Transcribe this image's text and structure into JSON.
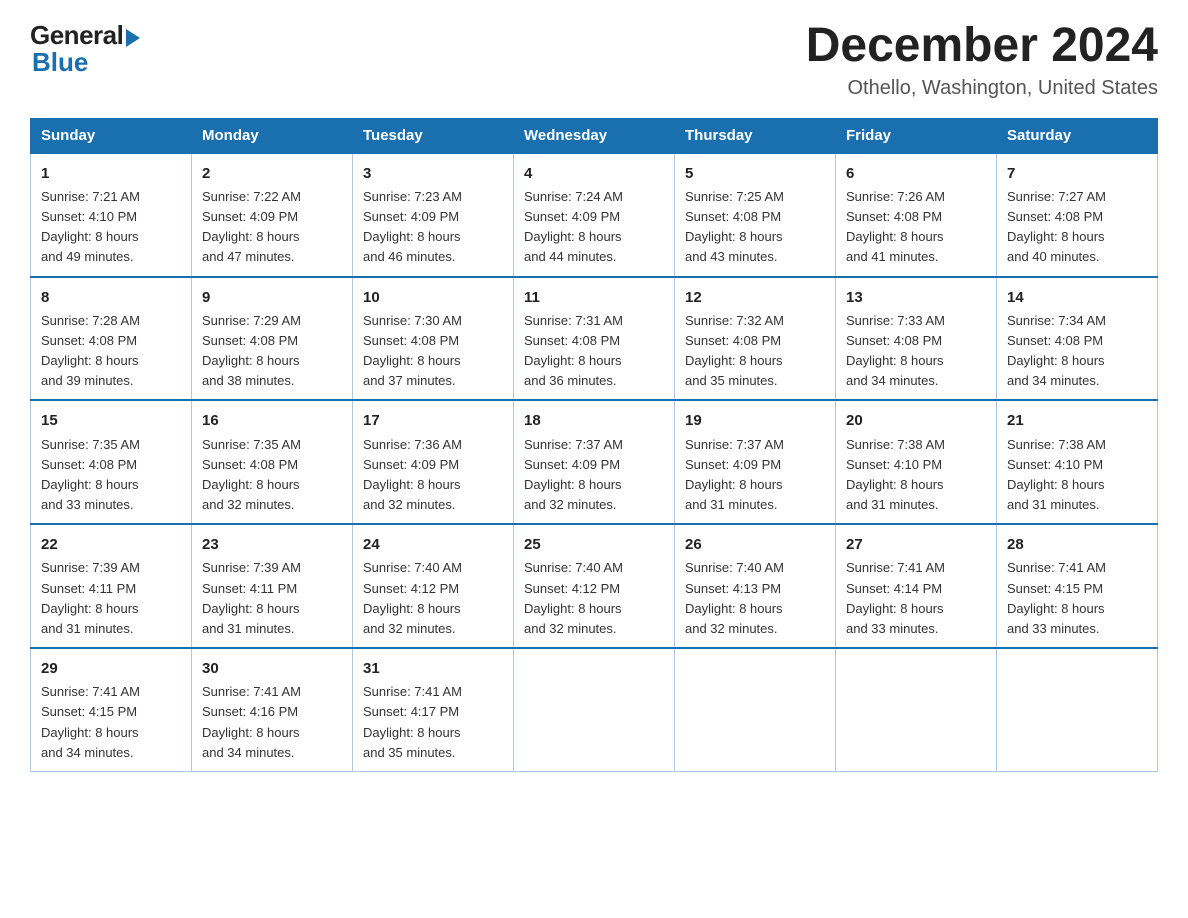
{
  "header": {
    "logo_general": "General",
    "logo_blue": "Blue",
    "month_title": "December 2024",
    "location": "Othello, Washington, United States"
  },
  "days_of_week": [
    "Sunday",
    "Monday",
    "Tuesday",
    "Wednesday",
    "Thursday",
    "Friday",
    "Saturday"
  ],
  "weeks": [
    [
      {
        "day": "1",
        "sunrise": "7:21 AM",
        "sunset": "4:10 PM",
        "daylight": "8 hours and 49 minutes."
      },
      {
        "day": "2",
        "sunrise": "7:22 AM",
        "sunset": "4:09 PM",
        "daylight": "8 hours and 47 minutes."
      },
      {
        "day": "3",
        "sunrise": "7:23 AM",
        "sunset": "4:09 PM",
        "daylight": "8 hours and 46 minutes."
      },
      {
        "day": "4",
        "sunrise": "7:24 AM",
        "sunset": "4:09 PM",
        "daylight": "8 hours and 44 minutes."
      },
      {
        "day": "5",
        "sunrise": "7:25 AM",
        "sunset": "4:08 PM",
        "daylight": "8 hours and 43 minutes."
      },
      {
        "day": "6",
        "sunrise": "7:26 AM",
        "sunset": "4:08 PM",
        "daylight": "8 hours and 41 minutes."
      },
      {
        "day": "7",
        "sunrise": "7:27 AM",
        "sunset": "4:08 PM",
        "daylight": "8 hours and 40 minutes."
      }
    ],
    [
      {
        "day": "8",
        "sunrise": "7:28 AM",
        "sunset": "4:08 PM",
        "daylight": "8 hours and 39 minutes."
      },
      {
        "day": "9",
        "sunrise": "7:29 AM",
        "sunset": "4:08 PM",
        "daylight": "8 hours and 38 minutes."
      },
      {
        "day": "10",
        "sunrise": "7:30 AM",
        "sunset": "4:08 PM",
        "daylight": "8 hours and 37 minutes."
      },
      {
        "day": "11",
        "sunrise": "7:31 AM",
        "sunset": "4:08 PM",
        "daylight": "8 hours and 36 minutes."
      },
      {
        "day": "12",
        "sunrise": "7:32 AM",
        "sunset": "4:08 PM",
        "daylight": "8 hours and 35 minutes."
      },
      {
        "day": "13",
        "sunrise": "7:33 AM",
        "sunset": "4:08 PM",
        "daylight": "8 hours and 34 minutes."
      },
      {
        "day": "14",
        "sunrise": "7:34 AM",
        "sunset": "4:08 PM",
        "daylight": "8 hours and 34 minutes."
      }
    ],
    [
      {
        "day": "15",
        "sunrise": "7:35 AM",
        "sunset": "4:08 PM",
        "daylight": "8 hours and 33 minutes."
      },
      {
        "day": "16",
        "sunrise": "7:35 AM",
        "sunset": "4:08 PM",
        "daylight": "8 hours and 32 minutes."
      },
      {
        "day": "17",
        "sunrise": "7:36 AM",
        "sunset": "4:09 PM",
        "daylight": "8 hours and 32 minutes."
      },
      {
        "day": "18",
        "sunrise": "7:37 AM",
        "sunset": "4:09 PM",
        "daylight": "8 hours and 32 minutes."
      },
      {
        "day": "19",
        "sunrise": "7:37 AM",
        "sunset": "4:09 PM",
        "daylight": "8 hours and 31 minutes."
      },
      {
        "day": "20",
        "sunrise": "7:38 AM",
        "sunset": "4:10 PM",
        "daylight": "8 hours and 31 minutes."
      },
      {
        "day": "21",
        "sunrise": "7:38 AM",
        "sunset": "4:10 PM",
        "daylight": "8 hours and 31 minutes."
      }
    ],
    [
      {
        "day": "22",
        "sunrise": "7:39 AM",
        "sunset": "4:11 PM",
        "daylight": "8 hours and 31 minutes."
      },
      {
        "day": "23",
        "sunrise": "7:39 AM",
        "sunset": "4:11 PM",
        "daylight": "8 hours and 31 minutes."
      },
      {
        "day": "24",
        "sunrise": "7:40 AM",
        "sunset": "4:12 PM",
        "daylight": "8 hours and 32 minutes."
      },
      {
        "day": "25",
        "sunrise": "7:40 AM",
        "sunset": "4:12 PM",
        "daylight": "8 hours and 32 minutes."
      },
      {
        "day": "26",
        "sunrise": "7:40 AM",
        "sunset": "4:13 PM",
        "daylight": "8 hours and 32 minutes."
      },
      {
        "day": "27",
        "sunrise": "7:41 AM",
        "sunset": "4:14 PM",
        "daylight": "8 hours and 33 minutes."
      },
      {
        "day": "28",
        "sunrise": "7:41 AM",
        "sunset": "4:15 PM",
        "daylight": "8 hours and 33 minutes."
      }
    ],
    [
      {
        "day": "29",
        "sunrise": "7:41 AM",
        "sunset": "4:15 PM",
        "daylight": "8 hours and 34 minutes."
      },
      {
        "day": "30",
        "sunrise": "7:41 AM",
        "sunset": "4:16 PM",
        "daylight": "8 hours and 34 minutes."
      },
      {
        "day": "31",
        "sunrise": "7:41 AM",
        "sunset": "4:17 PM",
        "daylight": "8 hours and 35 minutes."
      },
      null,
      null,
      null,
      null
    ]
  ],
  "labels": {
    "sunrise_prefix": "Sunrise: ",
    "sunset_prefix": "Sunset: ",
    "daylight_prefix": "Daylight: "
  }
}
